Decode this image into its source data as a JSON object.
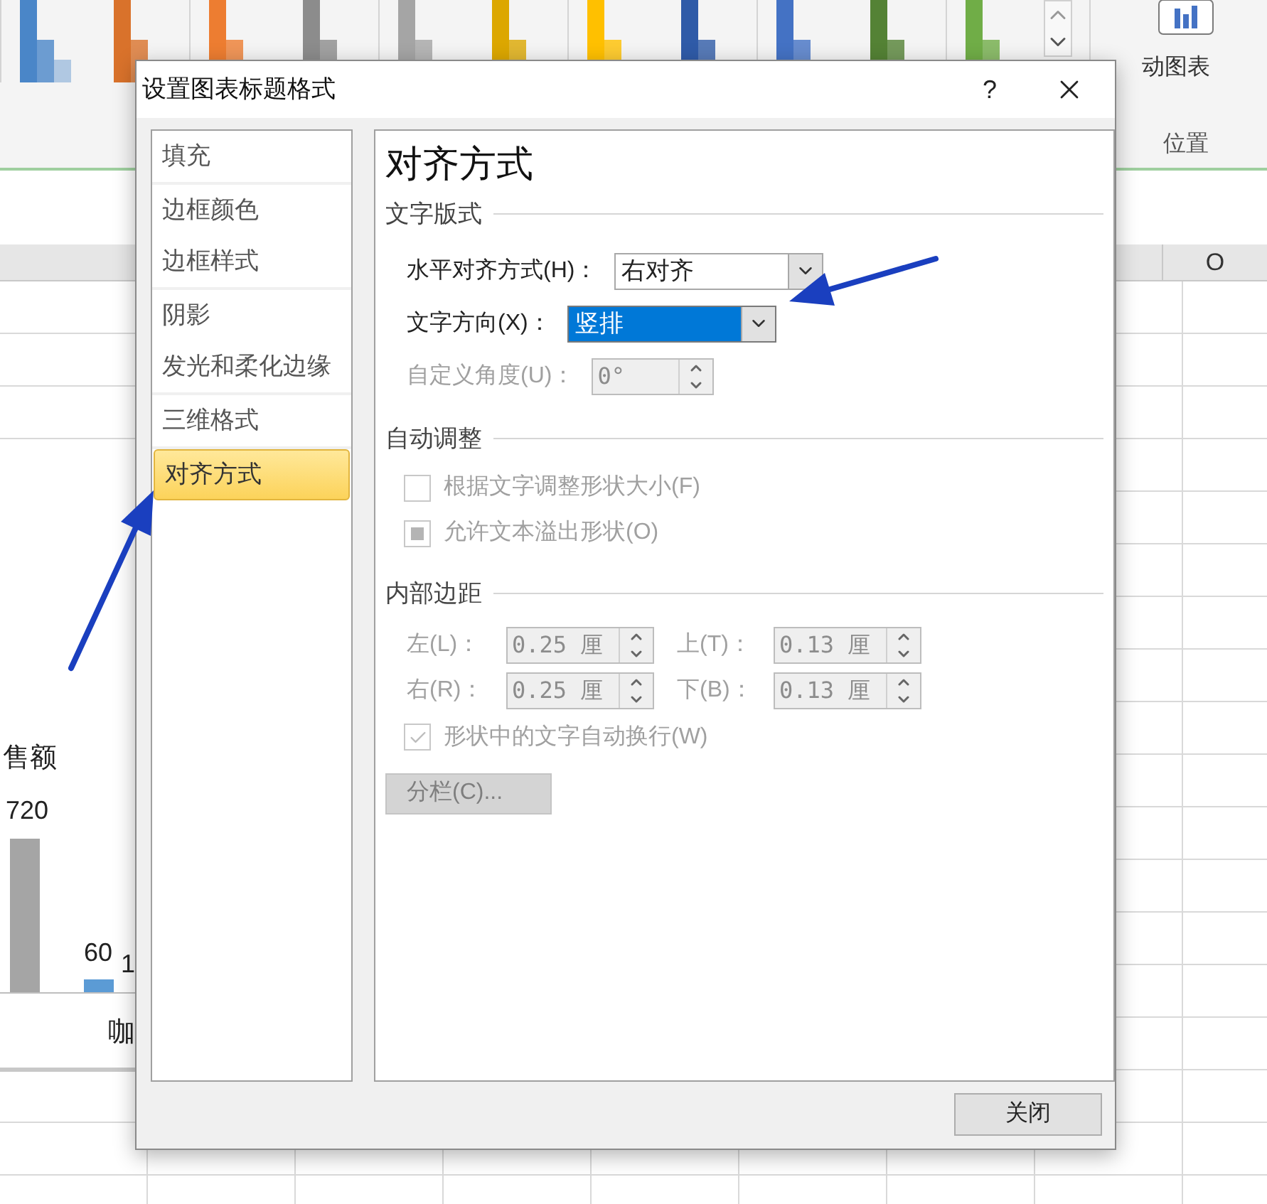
{
  "ribbon": {
    "chart_styles": [
      {
        "color": "#4a86c8"
      },
      {
        "color": "#d9722b"
      },
      {
        "color": "#ed7d31"
      },
      {
        "color": "#8c8c8c"
      },
      {
        "color": "#a5a5a5"
      },
      {
        "color": "#dca700"
      },
      {
        "color": "#ffc000"
      },
      {
        "color": "#2f5ba8"
      },
      {
        "color": "#4472c4"
      },
      {
        "color": "#548235"
      },
      {
        "color": "#70ad47"
      }
    ],
    "move_chart_label": "动图表",
    "group_label": "位置"
  },
  "sheet": {
    "column_header": "O",
    "chart": {
      "title": "售额",
      "value_labels": [
        "720",
        "60",
        "1"
      ],
      "category_label": "咖"
    }
  },
  "dialog": {
    "title": "设置图表标题格式",
    "help": "?",
    "nav_groups": [
      [
        {
          "label": "填充",
          "selected": false
        }
      ],
      [
        {
          "label": "边框颜色",
          "selected": false
        },
        {
          "label": "边框样式",
          "selected": false
        }
      ],
      [
        {
          "label": "阴影",
          "selected": false
        },
        {
          "label": "发光和柔化边缘",
          "selected": false
        }
      ],
      [
        {
          "label": "三维格式",
          "selected": false
        }
      ],
      [
        {
          "label": "对齐方式",
          "selected": true
        }
      ]
    ],
    "heading": "对齐方式",
    "text_layout": {
      "title": "文字版式",
      "fields": [
        {
          "label": "水平对齐方式(H)：",
          "value": "右对齐",
          "focused": false,
          "kind": "dropdown"
        },
        {
          "label": "文字方向(X)：",
          "value": "竖排",
          "focused": true,
          "kind": "dropdown"
        },
        {
          "label": "自定义角度(U)：",
          "value": "0°",
          "disabled": true,
          "kind": "spinner"
        }
      ]
    },
    "autofit": {
      "title": "自动调整",
      "options": [
        {
          "label": "根据文字调整形状大小(F)",
          "checked": false,
          "mixed": false,
          "disabled": true
        },
        {
          "label": "允许文本溢出形状(O)",
          "checked": false,
          "mixed": true,
          "disabled": true
        }
      ]
    },
    "margins": {
      "title": "内部边距",
      "fields": [
        {
          "label": "左(L)：",
          "value": "0.25 厘",
          "disabled": true
        },
        {
          "label": "上(T)：",
          "value": "0.13 厘",
          "disabled": true
        },
        {
          "label": "右(R)：",
          "value": "0.25 厘",
          "disabled": true
        },
        {
          "label": "下(B)：",
          "value": "0.13 厘",
          "disabled": true
        }
      ],
      "wrap": {
        "label": "形状中的文字自动换行(W)",
        "checked": true,
        "mixed": false,
        "disabled": true
      },
      "columns_button": {
        "label": "分栏(C)...",
        "disabled": true
      }
    },
    "close_button": "关闭"
  }
}
